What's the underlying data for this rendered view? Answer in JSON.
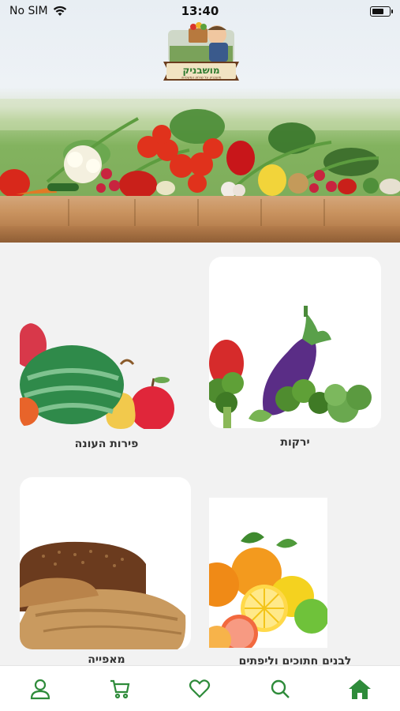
{
  "status": {
    "carrier": "No SIM",
    "time": "13:40",
    "battery_level": 0.7
  },
  "header": {
    "logo_text": "מושבניק",
    "logo_subtext": "מושבניק על שולחן המשפחה",
    "hero_alt": "fresh vegetables on wooden table"
  },
  "categories": [
    {
      "id": "vegetables",
      "label": "ירקות",
      "image": "vegetables"
    },
    {
      "id": "fruits",
      "label": "פירות העונה",
      "image": "fruits"
    },
    {
      "id": "citrus",
      "label": "לבנים חתוכים וליפתים",
      "image": "citrus"
    },
    {
      "id": "bakery",
      "label": "מאפייה",
      "image": "bakery"
    }
  ],
  "nav": {
    "items": [
      {
        "id": "profile",
        "icon": "user-icon"
      },
      {
        "id": "cart",
        "icon": "cart-icon"
      },
      {
        "id": "favorites",
        "icon": "heart-icon"
      },
      {
        "id": "search",
        "icon": "search-icon"
      },
      {
        "id": "home",
        "icon": "home-icon",
        "active": true
      }
    ],
    "color": "#2e8b3a",
    "active_color": "#1f6b2c"
  }
}
